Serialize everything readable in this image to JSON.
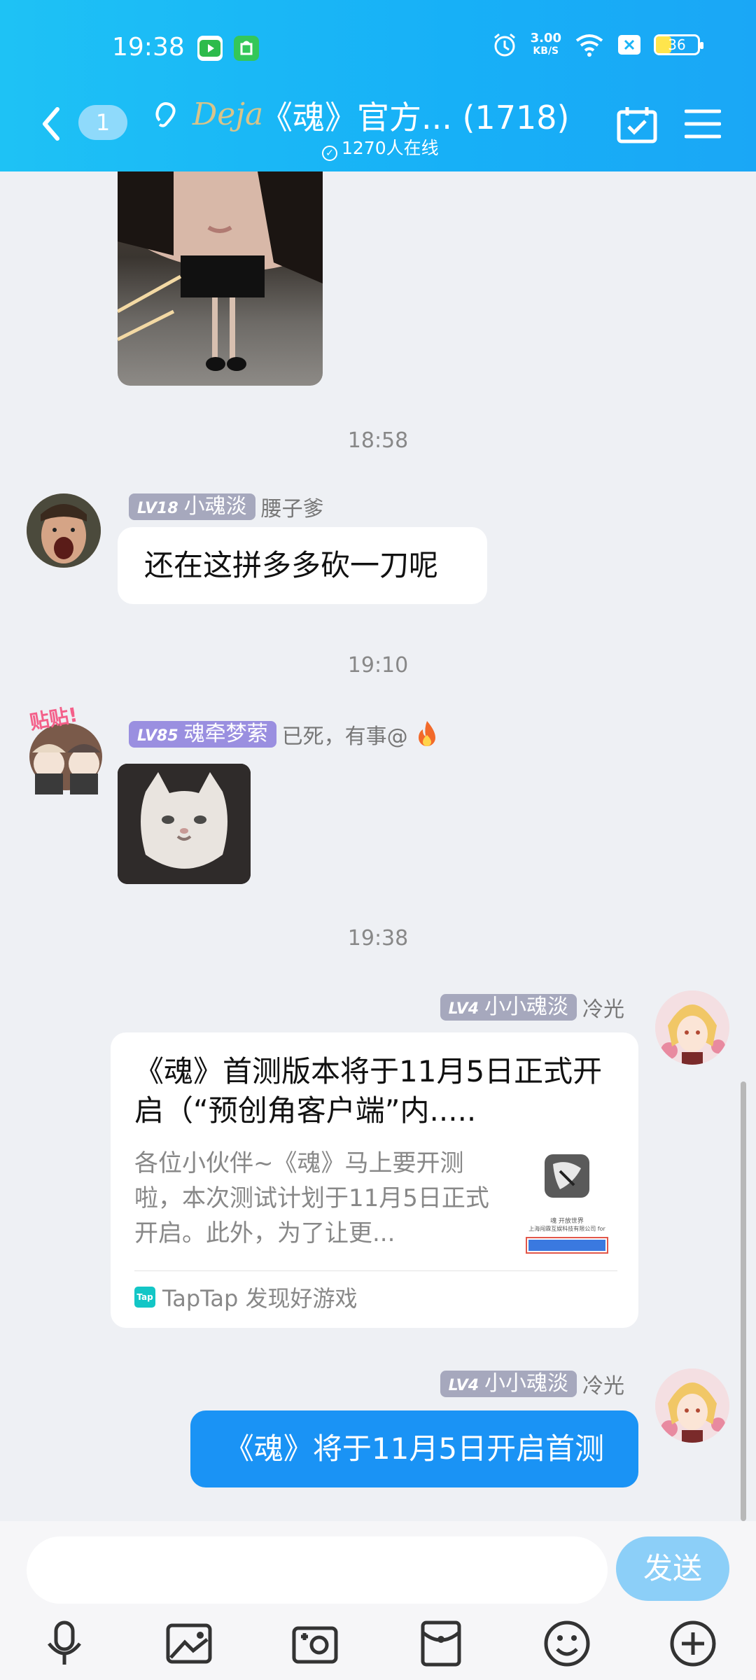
{
  "status_bar": {
    "time": "19:38",
    "net_speed_value": "3.00",
    "net_speed_unit": "KB/S",
    "battery": "36"
  },
  "header": {
    "unread_badge": "1",
    "logo_text": "Deja",
    "title": "《魂》官方... (1718)",
    "online": "1270人在线"
  },
  "chat": {
    "messages": [
      {
        "type": "timestamp",
        "text": "18:58"
      },
      {
        "type": "message",
        "level": "LV18",
        "title": "小魂淡",
        "name": "腰子爹",
        "text": "还在这拼多多砍一刀呢"
      },
      {
        "type": "timestamp",
        "text": "19:10"
      },
      {
        "type": "message",
        "level": "LV85",
        "title": "魂牵梦萦",
        "name": "已死，有事@",
        "avatar_text": "贴贴!"
      },
      {
        "type": "timestamp",
        "text": "19:38"
      },
      {
        "type": "message",
        "level": "LV4",
        "title": "小小魂淡",
        "name": "冷光"
      },
      {
        "type": "message",
        "level": "LV4",
        "title": "小小魂淡",
        "name": "冷光",
        "text": "《魂》将于11月5日开启首测"
      }
    ],
    "share_card": {
      "title": "《魂》首测版本将于11月5日正式开启（“预创角客户端”内.....",
      "description": "各位小伙伴~《魂》马上要开测啦，本次测试计划于11月5日正式开启。此外，为了让更...",
      "thumb_caption_1": "魂 开放世界",
      "thumb_caption_2": "上海闯霖互娱科技有限公司 for",
      "source": "TapTap 发现好游戏",
      "source_icon": "Tap"
    }
  },
  "input": {
    "placeholder": "",
    "send_label": "发送"
  },
  "colors": {
    "header": "#1ab4f6",
    "bubble_self": "#1a93f5",
    "level_tag_gray": "#a6a8bd",
    "level_tag_purple": "#9a8fe0",
    "send_button": "#8ccff8"
  },
  "toolbar_icons": [
    "microphone-icon",
    "image-icon",
    "camera-icon",
    "red-envelope-icon",
    "emoji-icon",
    "plus-icon"
  ]
}
